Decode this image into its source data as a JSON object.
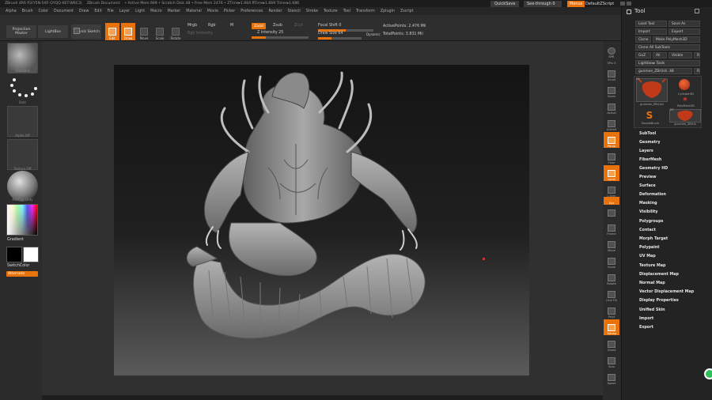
{
  "titlebar": {
    "items": [
      "ZBrush 4R6 P2(Y5N-SXF-QYQQ-6ET-W6C3)",
      "ZBrush Document",
      "• Active Mem 669 • Scratch Disk 48 • Free Mem 2476 • ZTime▸1.664 RTime▸1.669 Timer▸1.686"
    ],
    "quicksave": "QuickSave",
    "seethrough": "See-through 0",
    "menus": "Menus",
    "default_script": "DefaultZScript"
  },
  "menubar": {
    "items": [
      "Alpha",
      "Brush",
      "Color",
      "Document",
      "Draw",
      "Edit",
      "File",
      "Layer",
      "Light",
      "Macro",
      "Marker",
      "Material",
      "Movie",
      "Picker",
      "Preferences",
      "Render",
      "Stencil",
      "Stroke",
      "Texture",
      "Tool",
      "Transform",
      "Zplugin",
      "Zscript"
    ]
  },
  "toolbar": {
    "projection_master": "Projection Master",
    "lightbox": "LightBox",
    "quick_sketch": "Quick Sketch",
    "edit": "Edit",
    "draw": "Draw",
    "move": "Move",
    "scale": "Scale",
    "rotate": "Rotate",
    "mrgb": "Mrgb",
    "rgb": "Rgb",
    "m": "M",
    "rgb_intensity": "Rgb Intensity",
    "zadd": "Zadd",
    "zsub": "Zsub",
    "zcut": "Zcut",
    "z_intensity": "Z Intensity 25",
    "z_intensity_value": 25,
    "focal_shift": "Focal Shift 0",
    "draw_size": "Draw Size 64",
    "dynamic": "Dynamic",
    "active_points": "ActivePoints: 2.476 Mil",
    "total_points": "TotalPoints: 3.831 Mil"
  },
  "leftshelf": {
    "brush_label": "Standard",
    "stroke_label": "Dots",
    "alpha_label": "Alpha Off",
    "texture_label": "Texture Off",
    "material_label": "MatCap Gray",
    "gradient": "Gradient",
    "switchcolor": "SwitchColor",
    "alternate": "Alternate"
  },
  "rightshelf": {
    "items": [
      "BPR",
      "SPix 3",
      "Scroll",
      "Zoom",
      "Actual",
      "AAHalf",
      "Persp",
      "Floor",
      "Local",
      "L.Sym",
      "Xyz",
      "",
      "Frame",
      "Move",
      "Scale",
      "Rotate",
      "Line Fill",
      "Polyf",
      "Transp",
      "Ghost",
      "Solo",
      "Xpose"
    ]
  },
  "toolpanel": {
    "title": "Tool",
    "buttons": [
      "Load Tool",
      "Save As",
      "Import",
      "Export",
      "Clone",
      "Make PolyMesh3D",
      "Clone All SubTools",
      "GoZ",
      "All",
      "Visible",
      "R",
      "Lightbox▸ Tools"
    ],
    "current_tool": "gunmee_ZBrUsh. 48",
    "current_tool_count": "R",
    "tools": [
      {
        "label": "gunmee_ZBrUsh",
        "count": "27"
      },
      {
        "label": "Cylinder3D",
        "count": ""
      },
      {
        "label": "PolyMesh3D",
        "count": ""
      },
      {
        "label": "SimpleBrush",
        "count": ""
      },
      {
        "label": "gunmee_ZBrUs",
        "count": "27"
      }
    ],
    "menu": [
      "SubTool",
      "Geometry",
      "Layers",
      "FiberMesh",
      "Geometry HD",
      "Preview",
      "Surface",
      "Deformation",
      "Masking",
      "Visibility",
      "Polygroups",
      "Contact",
      "Morph Target",
      "Polypaint",
      "UV Map",
      "Texture Map",
      "Displacement Map",
      "Normal Map",
      "Vector Displacement Map",
      "Display Properties",
      "Unified Skin",
      "Import",
      "Export"
    ]
  },
  "colors": {
    "accent": "#e8720c",
    "model": "#9a9a9a"
  }
}
